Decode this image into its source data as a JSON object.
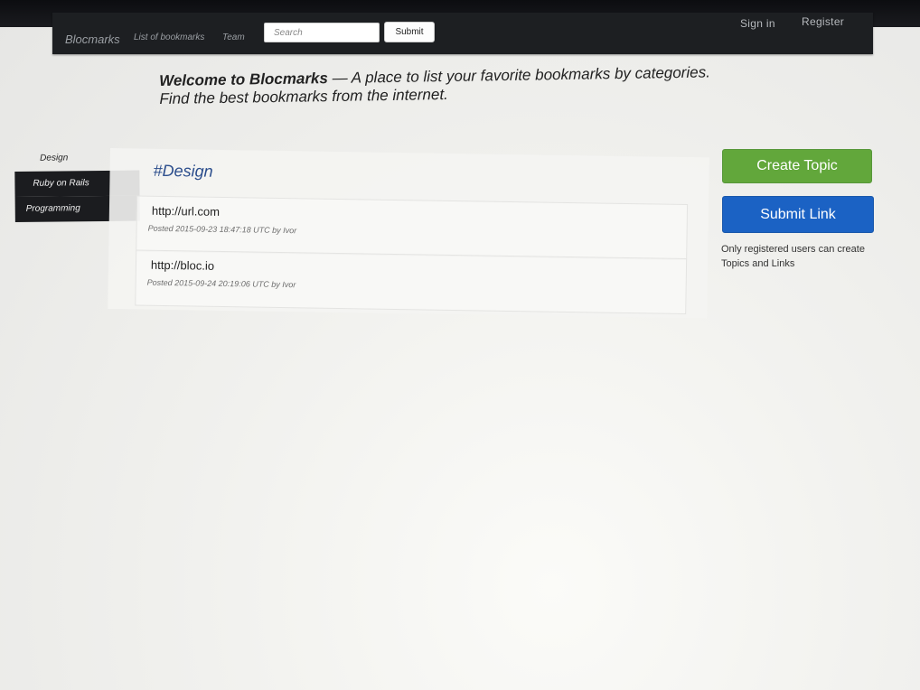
{
  "navbar": {
    "brand": "Blocmarks",
    "links": [
      "List of bookmarks",
      "Team"
    ],
    "search_placeholder": "Search",
    "submit_label": "Submit",
    "sign_in": "Sign in",
    "register": "Register"
  },
  "welcome": {
    "title": "Welcome to Blocmarks",
    "dash": " — ",
    "text": "A place to list your favorite bookmarks by categories. Find the best bookmarks from the internet."
  },
  "sidebar": {
    "items": [
      {
        "label": "Design",
        "active": true
      },
      {
        "label": "Ruby on Rails",
        "active": false
      },
      {
        "label": "Programming",
        "active": false
      }
    ]
  },
  "topic": {
    "title": "#Design",
    "bookmarks": [
      {
        "url": "http://url.com",
        "meta": "Posted 2015-09-23 18:47:18 UTC by Ivor"
      },
      {
        "url": "http://bloc.io",
        "meta": "Posted 2015-09-24 20:19:06 UTC by Ivor"
      }
    ]
  },
  "actions": {
    "create_topic": "Create Topic",
    "submit_link": "Submit Link",
    "note": "Only registered users can create Topics and Links"
  },
  "colors": {
    "navbar": "#1d1f22",
    "create_topic": "#62a73b",
    "submit_link": "#1b62c4",
    "topic_title": "#2b4d8c"
  }
}
